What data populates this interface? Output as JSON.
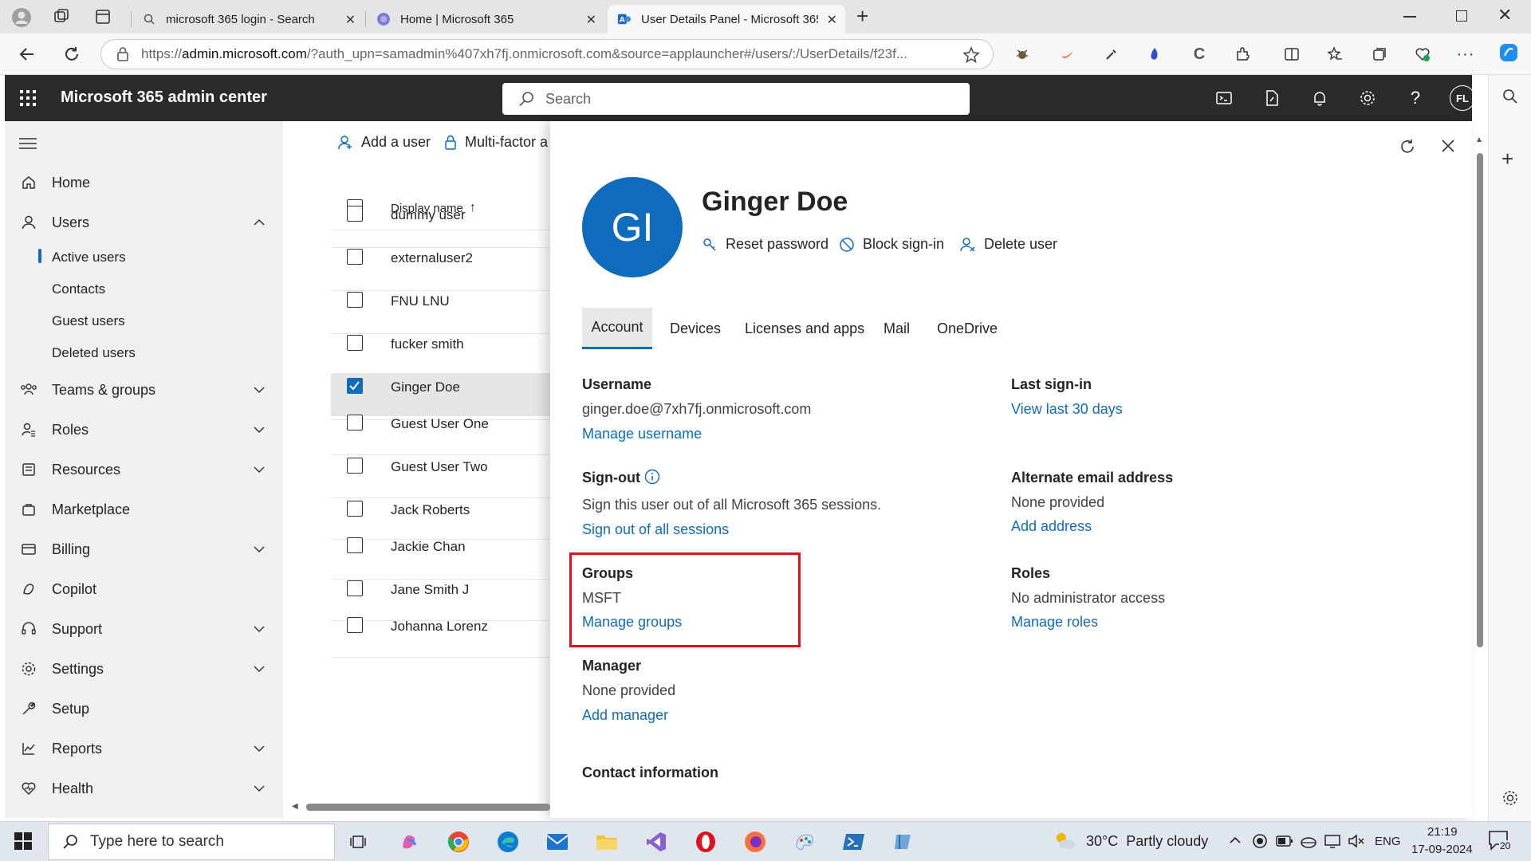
{
  "browser": {
    "tabs": [
      {
        "title": "microsoft 365 login - Search"
      },
      {
        "title": "Home | Microsoft 365"
      },
      {
        "title": "User Details Panel - Microsoft 365"
      }
    ],
    "url_prefix": "https://",
    "url_host": "admin.microsoft.com",
    "url_rest": "/?auth_upn=samadmin%407xh7fj.onmicrosoft.com&source=applauncher#/users/:/UserDetails/f23f..."
  },
  "header": {
    "app_title": "Microsoft 365 admin center",
    "search_placeholder": "Search",
    "avatar_initials": "FL"
  },
  "nav": {
    "items": [
      {
        "label": "Home",
        "icon": "home-icon"
      },
      {
        "label": "Users",
        "icon": "user-icon"
      },
      {
        "label": "Teams & groups",
        "icon": "teams-icon"
      },
      {
        "label": "Roles",
        "icon": "roles-icon"
      },
      {
        "label": "Resources",
        "icon": "resources-icon"
      },
      {
        "label": "Marketplace",
        "icon": "marketplace-icon"
      },
      {
        "label": "Billing",
        "icon": "billing-icon"
      },
      {
        "label": "Copilot",
        "icon": "copilot-icon"
      },
      {
        "label": "Support",
        "icon": "support-icon"
      },
      {
        "label": "Settings",
        "icon": "settings-icon"
      },
      {
        "label": "Setup",
        "icon": "setup-icon"
      },
      {
        "label": "Reports",
        "icon": "reports-icon"
      },
      {
        "label": "Health",
        "icon": "health-icon"
      }
    ],
    "users_sub": [
      "Active users",
      "Contacts",
      "Guest users",
      "Deleted users"
    ]
  },
  "userlist": {
    "toolbar_add": "Add a user",
    "toolbar_mfa": "Multi-factor a",
    "column_header": "Display name",
    "rows": [
      {
        "name": "dummy user"
      },
      {
        "name": "externaluser2"
      },
      {
        "name": "FNU LNU"
      },
      {
        "name": "fucker smith"
      },
      {
        "name": "Ginger Doe"
      },
      {
        "name": "Guest User One"
      },
      {
        "name": "Guest User Two"
      },
      {
        "name": "Jack Roberts"
      },
      {
        "name": "Jackie Chan"
      },
      {
        "name": "Jane Smith J"
      },
      {
        "name": "Johanna Lorenz"
      }
    ]
  },
  "panel": {
    "initials": "GI",
    "user_name": "Ginger Doe",
    "actions": {
      "reset": "Reset password",
      "block": "Block sign-in",
      "delete": "Delete user"
    },
    "tabs": [
      "Account",
      "Devices",
      "Licenses and apps",
      "Mail",
      "OneDrive"
    ],
    "username_label": "Username",
    "username_value": "ginger.doe@7xh7fj.onmicrosoft.com",
    "manage_username": "Manage username",
    "signout_label": "Sign-out",
    "signout_text": "Sign this user out of all Microsoft 365 sessions.",
    "signout_link": "Sign out of all sessions",
    "groups_label": "Groups",
    "groups_value": "MSFT",
    "manage_groups": "Manage groups",
    "manager_label": "Manager",
    "manager_value": "None provided",
    "add_manager": "Add manager",
    "contact_label": "Contact information",
    "last_signin_label": "Last sign-in",
    "last_signin_link": "View last 30 days",
    "alt_email_label": "Alternate email address",
    "alt_email_value": "None provided",
    "add_address": "Add address",
    "roles_label": "Roles",
    "roles_value": "No administrator access",
    "manage_roles": "Manage roles",
    "highlight_color": "#e0101e"
  },
  "taskbar": {
    "search_placeholder": "Type here to search",
    "weather": "30°C  Partly cloudy",
    "lang": "ENG",
    "time": "21:19",
    "date": "17-09-2024",
    "notif_count": "20"
  }
}
